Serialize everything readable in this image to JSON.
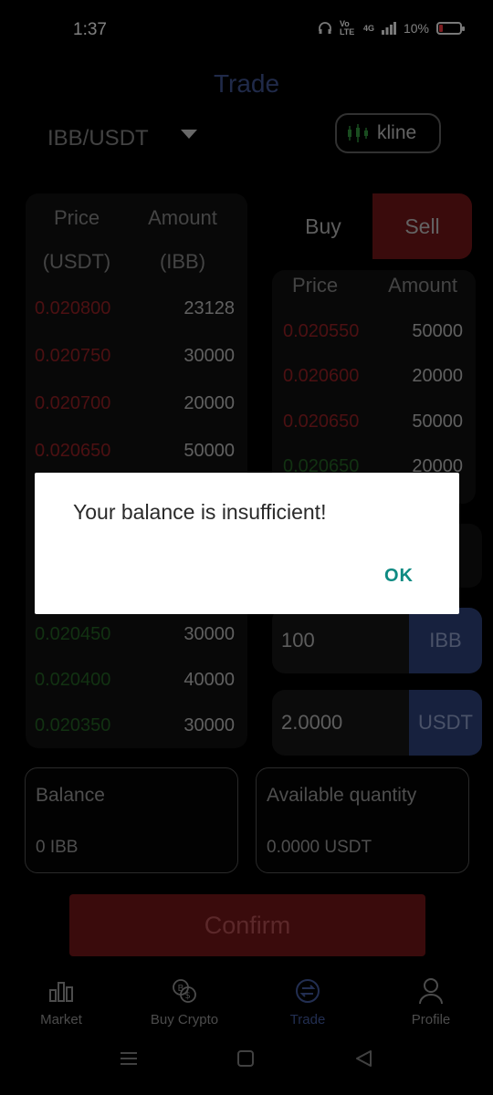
{
  "status": {
    "time": "1:37",
    "net1": "Vo LTE",
    "net2": "4G",
    "battery": "10%"
  },
  "header": {
    "title": "Trade",
    "pair": "IBB/USDT",
    "kline_label": "kline"
  },
  "left_book": {
    "head_price": "Price",
    "head_price_unit": "(USDT)",
    "head_amount": "Amount",
    "head_amount_unit": "(IBB)",
    "asks": [
      {
        "price": "0.020800",
        "amount": "23128"
      },
      {
        "price": "0.020750",
        "amount": "30000"
      },
      {
        "price": "0.020700",
        "amount": "20000"
      },
      {
        "price": "0.020650",
        "amount": "50000"
      }
    ],
    "bids": [
      {
        "price": "0.020450",
        "amount": "30000"
      },
      {
        "price": "0.020400",
        "amount": "40000"
      },
      {
        "price": "0.020350",
        "amount": "30000"
      }
    ]
  },
  "tabs": {
    "buy": "Buy",
    "sell": "Sell"
  },
  "right_book": {
    "head_price": "Price",
    "head_amount": "Amount",
    "rows": [
      {
        "price": "0.020550",
        "amount": "50000",
        "side": "red"
      },
      {
        "price": "0.020600",
        "amount": "20000",
        "side": "red"
      },
      {
        "price": "0.020650",
        "amount": "50000",
        "side": "red"
      },
      {
        "price": "0.020650",
        "amount": "20000",
        "side": "green"
      }
    ]
  },
  "inputs": {
    "quantity": {
      "value": "100",
      "unit": "IBB"
    },
    "total": {
      "value": "2.0000",
      "unit": "USDT"
    }
  },
  "balance": {
    "label": "Balance",
    "value": "0 IBB"
  },
  "available": {
    "label": "Available quantity",
    "value": "0.0000 USDT"
  },
  "confirm_label": "Confirm",
  "nav": {
    "market": "Market",
    "buy_crypto": "Buy Crypto",
    "trade": "Trade",
    "profile": "Profile"
  },
  "dialog": {
    "message": "Your balance is insufficient!",
    "ok": "OK"
  },
  "colors": {
    "accent_blue": "#3f5594",
    "sell_red": "#6b1417",
    "teal_ok": "#0e8a82"
  }
}
